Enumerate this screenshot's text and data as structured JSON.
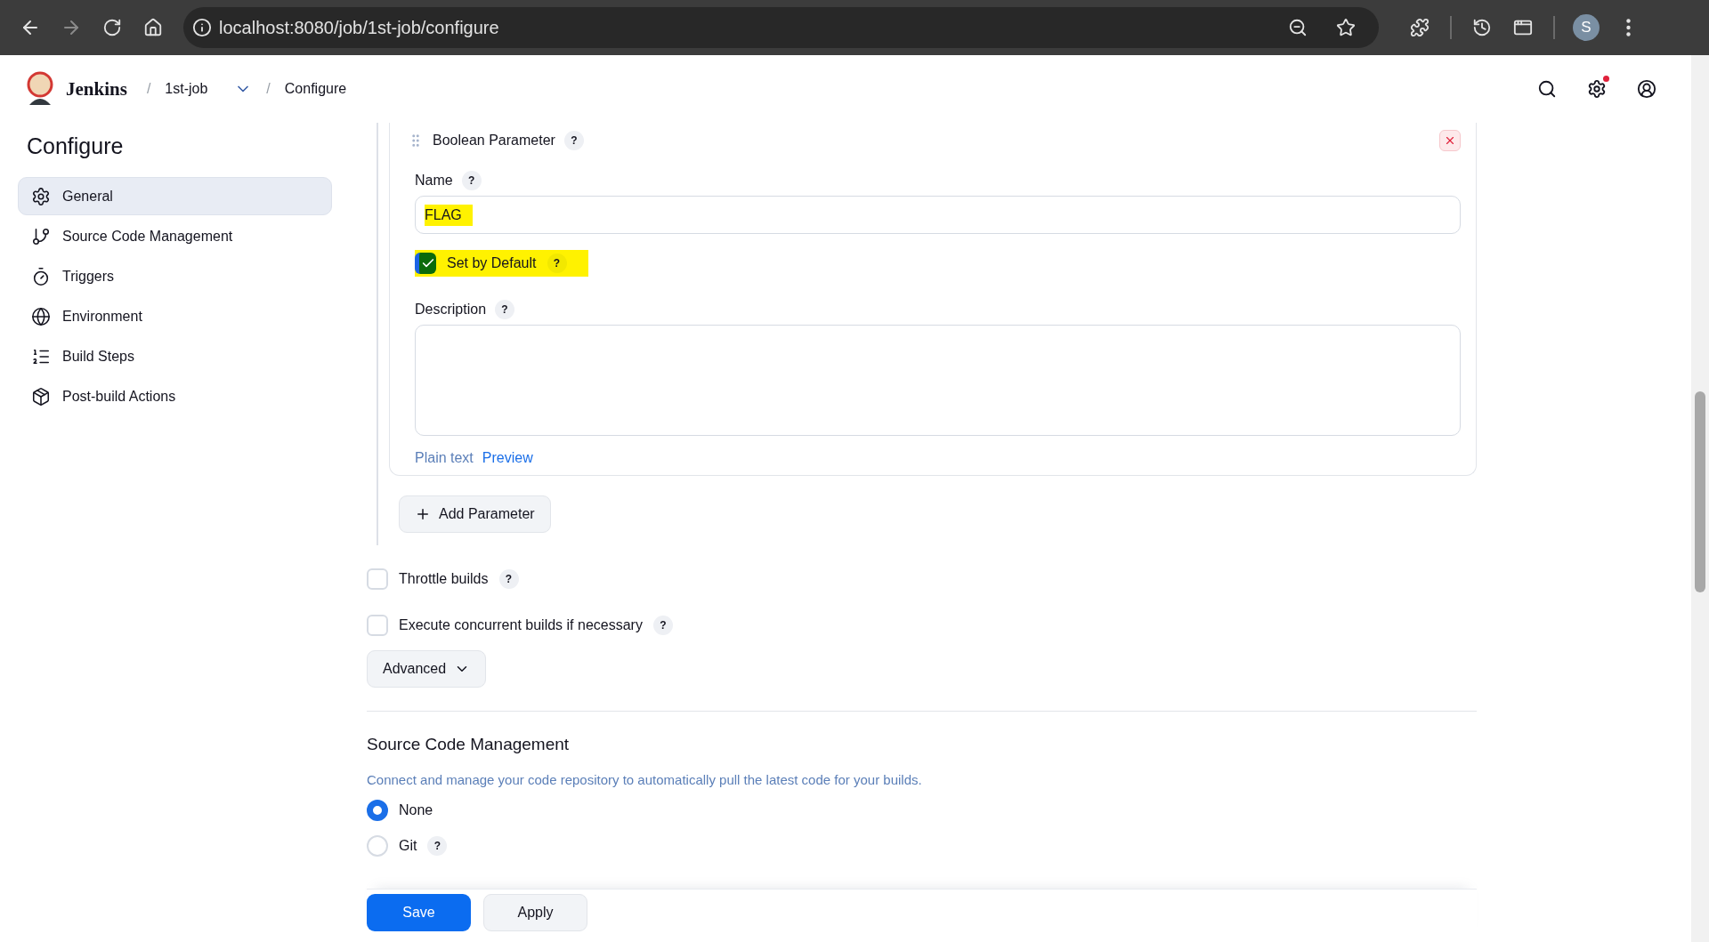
{
  "browser": {
    "url": "localhost:8080/job/1st-job/configure",
    "profile_initial": "S"
  },
  "header": {
    "brand": "Jenkins",
    "breadcrumbs": [
      {
        "separator": "/",
        "label": "1st-job"
      },
      {
        "separator": "/",
        "label": "Configure"
      }
    ],
    "notification": true
  },
  "sidebar": {
    "title": "Configure",
    "items": [
      {
        "label": "General",
        "kind": "gear",
        "selected": true
      },
      {
        "label": "Source Code Management",
        "kind": "branch",
        "selected": false
      },
      {
        "label": "Triggers",
        "kind": "timer",
        "selected": false
      },
      {
        "label": "Environment",
        "kind": "globe",
        "selected": false
      },
      {
        "label": "Build Steps",
        "kind": "list",
        "selected": false
      },
      {
        "label": "Post-build Actions",
        "kind": "package",
        "selected": false
      }
    ]
  },
  "parameter": {
    "type": "Boolean Parameter",
    "help": "?",
    "name": {
      "label": "Name",
      "help": "?",
      "value": "FLAG",
      "highlighted": true
    },
    "default": {
      "label": "Set by Default",
      "help": "?",
      "checked": true,
      "highlighted": true
    },
    "description": {
      "label": "Description",
      "help": "?"
    },
    "formats": [
      {
        "label": "Plain text",
        "selected": true
      },
      {
        "label": "Preview",
        "selected": false
      }
    ]
  },
  "add_parameter": "Add Parameter",
  "options": [
    {
      "label": "Throttle builds",
      "help": "?",
      "checked": false
    },
    {
      "label": "Execute concurrent builds if necessary",
      "help": "?",
      "checked": false
    }
  ],
  "advanced": "Advanced",
  "scm": {
    "title": "Source Code Management",
    "description": "Connect and manage your code repository to automatically pull the latest code for your builds.",
    "choices": [
      {
        "label": "None",
        "selected": true
      },
      {
        "label": "Git",
        "help": "?",
        "selected": false
      }
    ]
  },
  "actions": [
    {
      "label": "Save",
      "kind": "primary"
    },
    {
      "label": "Apply",
      "kind": "secondary"
    }
  ]
}
